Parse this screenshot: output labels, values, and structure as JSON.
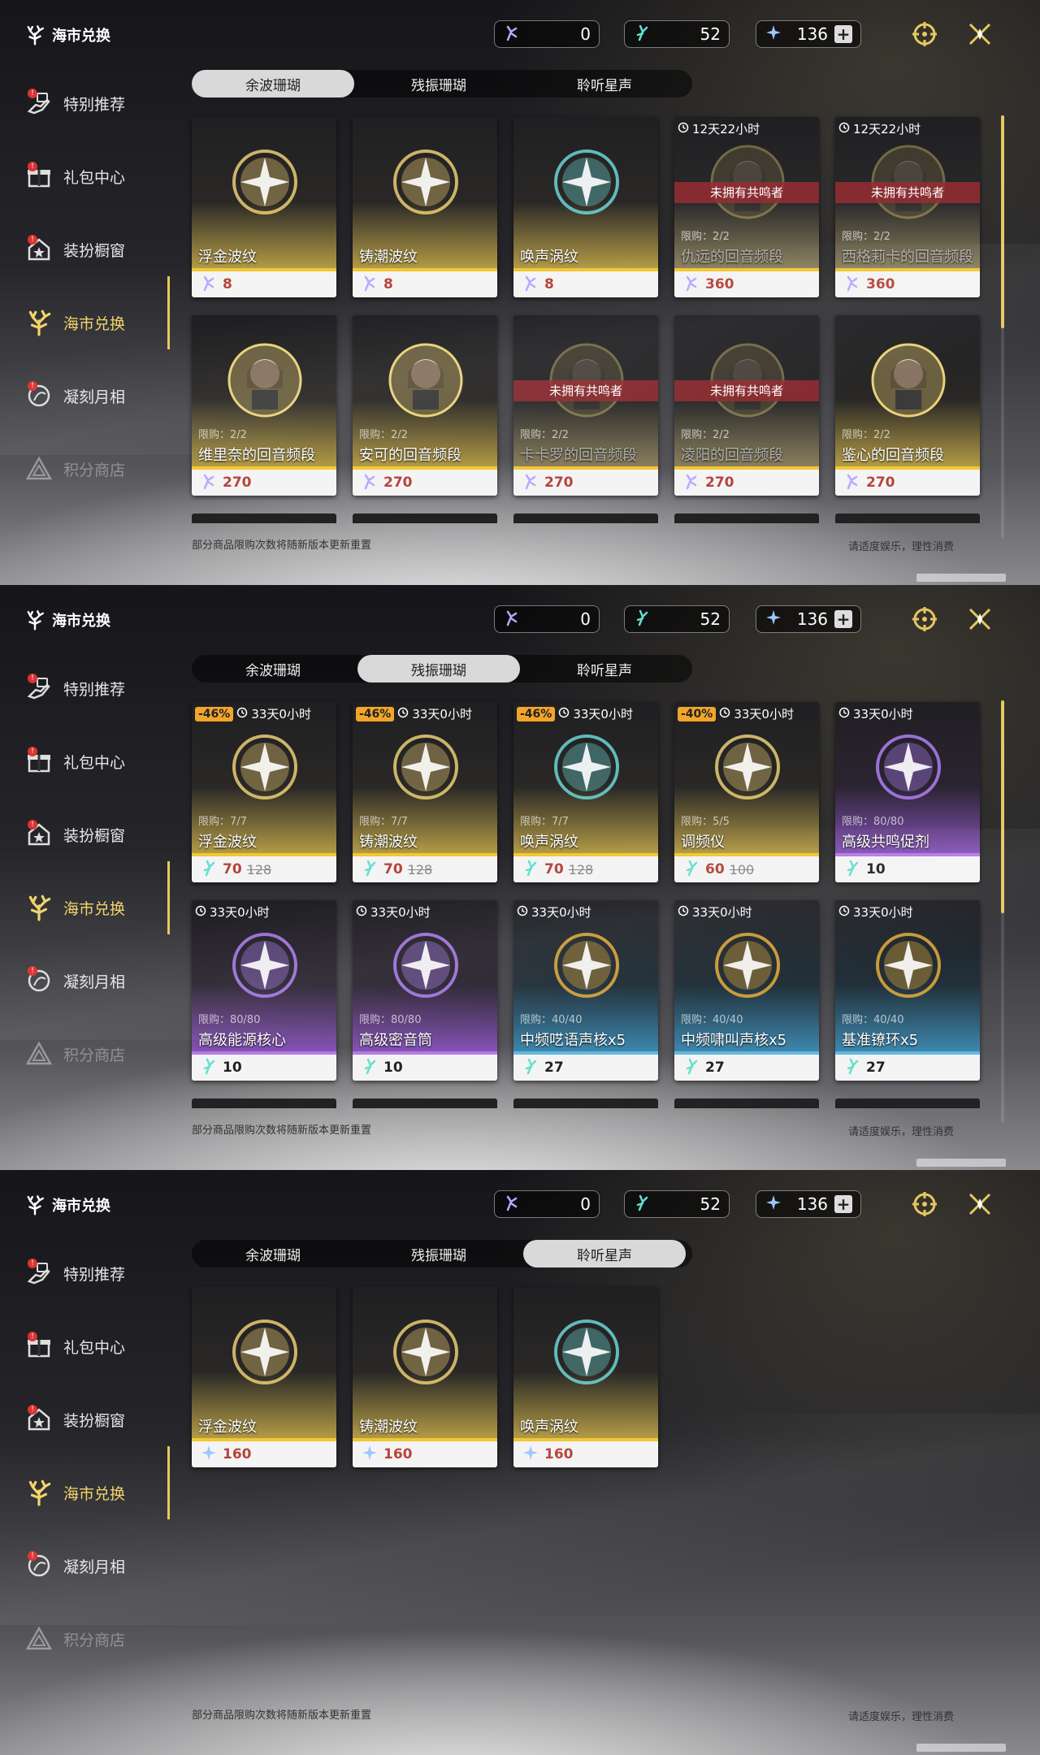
{
  "title": "海市兑换",
  "sidebar": [
    {
      "label": "特别推荐",
      "icon": "hand-icon",
      "badge": "!"
    },
    {
      "label": "礼包中心",
      "icon": "gift-icon",
      "badge": "!"
    },
    {
      "label": "装扮橱窗",
      "icon": "house-star-icon",
      "badge": "!"
    },
    {
      "label": "海市兑换",
      "icon": "coral-icon",
      "active": true
    },
    {
      "label": "凝刻月相",
      "icon": "moon-icon",
      "badge": "!"
    },
    {
      "label": "积分商店",
      "icon": "triangle-icon",
      "dim": true
    }
  ],
  "currencies": [
    {
      "icon": "coral-currency-icon",
      "value": "0"
    },
    {
      "icon": "afterglow-coral-icon",
      "value": "52"
    },
    {
      "icon": "star-currency-icon",
      "value": "136",
      "plus": "+"
    }
  ],
  "tabs": [
    "余波珊瑚",
    "残振珊瑚",
    "聆听星声"
  ],
  "footer": {
    "note": "部分商品限购次数将随新版本更新重置",
    "right": "请适度娱乐，理性消费"
  },
  "panels": [
    {
      "active_tab": 0,
      "cards": [
        {
          "name": "浮金波纹",
          "price": "8",
          "color": "gold"
        },
        {
          "name": "铸潮波纹",
          "price": "8",
          "color": "gold"
        },
        {
          "name": "唤声涡纹",
          "price": "8",
          "color": "gold"
        },
        {
          "name": "仇远的回音频段",
          "price": "360",
          "timer": "12天22小时",
          "limit": "限购：2/2",
          "noown": "未拥有共鸣者",
          "color": "grey",
          "dim": true
        },
        {
          "name": "西格莉卡的回音频段",
          "price": "360",
          "timer": "12天22小时",
          "limit": "限购：2/2",
          "noown": "未拥有共鸣者",
          "color": "grey",
          "dim": true
        },
        {
          "name": "维里奈的回音频段",
          "price": "270",
          "limit": "限购：2/2",
          "color": "gold"
        },
        {
          "name": "安可的回音频段",
          "price": "270",
          "limit": "限购：2/2",
          "color": "gold"
        },
        {
          "name": "卡卡罗的回音频段",
          "price": "270",
          "limit": "限购：2/2",
          "noown": "未拥有共鸣者",
          "color": "grey",
          "dim": true
        },
        {
          "name": "凌阳的回音频段",
          "price": "270",
          "limit": "限购：2/2",
          "noown": "未拥有共鸣者",
          "color": "grey",
          "dim": true
        },
        {
          "name": "鉴心的回音频段",
          "price": "270",
          "limit": "限购：2/2",
          "color": "gold"
        }
      ]
    },
    {
      "active_tab": 1,
      "cards": [
        {
          "name": "浮金波纹",
          "price": "70",
          "old": "128",
          "discount": "-46%",
          "timer": "33天0小时",
          "limit": "限购：7/7",
          "color": "gold"
        },
        {
          "name": "铸潮波纹",
          "price": "70",
          "old": "128",
          "discount": "-46%",
          "timer": "33天0小时",
          "limit": "限购：7/7",
          "color": "gold"
        },
        {
          "name": "唤声涡纹",
          "price": "70",
          "old": "128",
          "discount": "-46%",
          "timer": "33天0小时",
          "limit": "限购：7/7",
          "color": "gold"
        },
        {
          "name": "调频仪",
          "price": "60",
          "old": "100",
          "discount": "-40%",
          "timer": "33天0小时",
          "limit": "限购：5/5",
          "color": "gold"
        },
        {
          "name": "高级共鸣促剂",
          "price": "10",
          "timer": "33天0小时",
          "limit": "限购：80/80",
          "color": "purple"
        },
        {
          "name": "高级能源核心",
          "price": "10",
          "timer": "33天0小时",
          "limit": "限购：80/80",
          "color": "purple"
        },
        {
          "name": "高级密音筒",
          "price": "10",
          "timer": "33天0小时",
          "limit": "限购：80/80",
          "color": "purple"
        },
        {
          "name": "中频呓语声核x5",
          "price": "27",
          "timer": "33天0小时",
          "limit": "限购：40/40",
          "color": "blue"
        },
        {
          "name": "中频啸叫声核x5",
          "price": "27",
          "timer": "33天0小时",
          "limit": "限购：40/40",
          "color": "blue"
        },
        {
          "name": "基准镣环x5",
          "price": "27",
          "timer": "33天0小时",
          "limit": "限购：40/40",
          "color": "blue"
        }
      ]
    },
    {
      "active_tab": 2,
      "cards": [
        {
          "name": "浮金波纹",
          "price": "160",
          "color": "gold"
        },
        {
          "name": "铸潮波纹",
          "price": "160",
          "color": "gold"
        },
        {
          "name": "唤声涡纹",
          "price": "160",
          "color": "gold"
        }
      ]
    }
  ]
}
